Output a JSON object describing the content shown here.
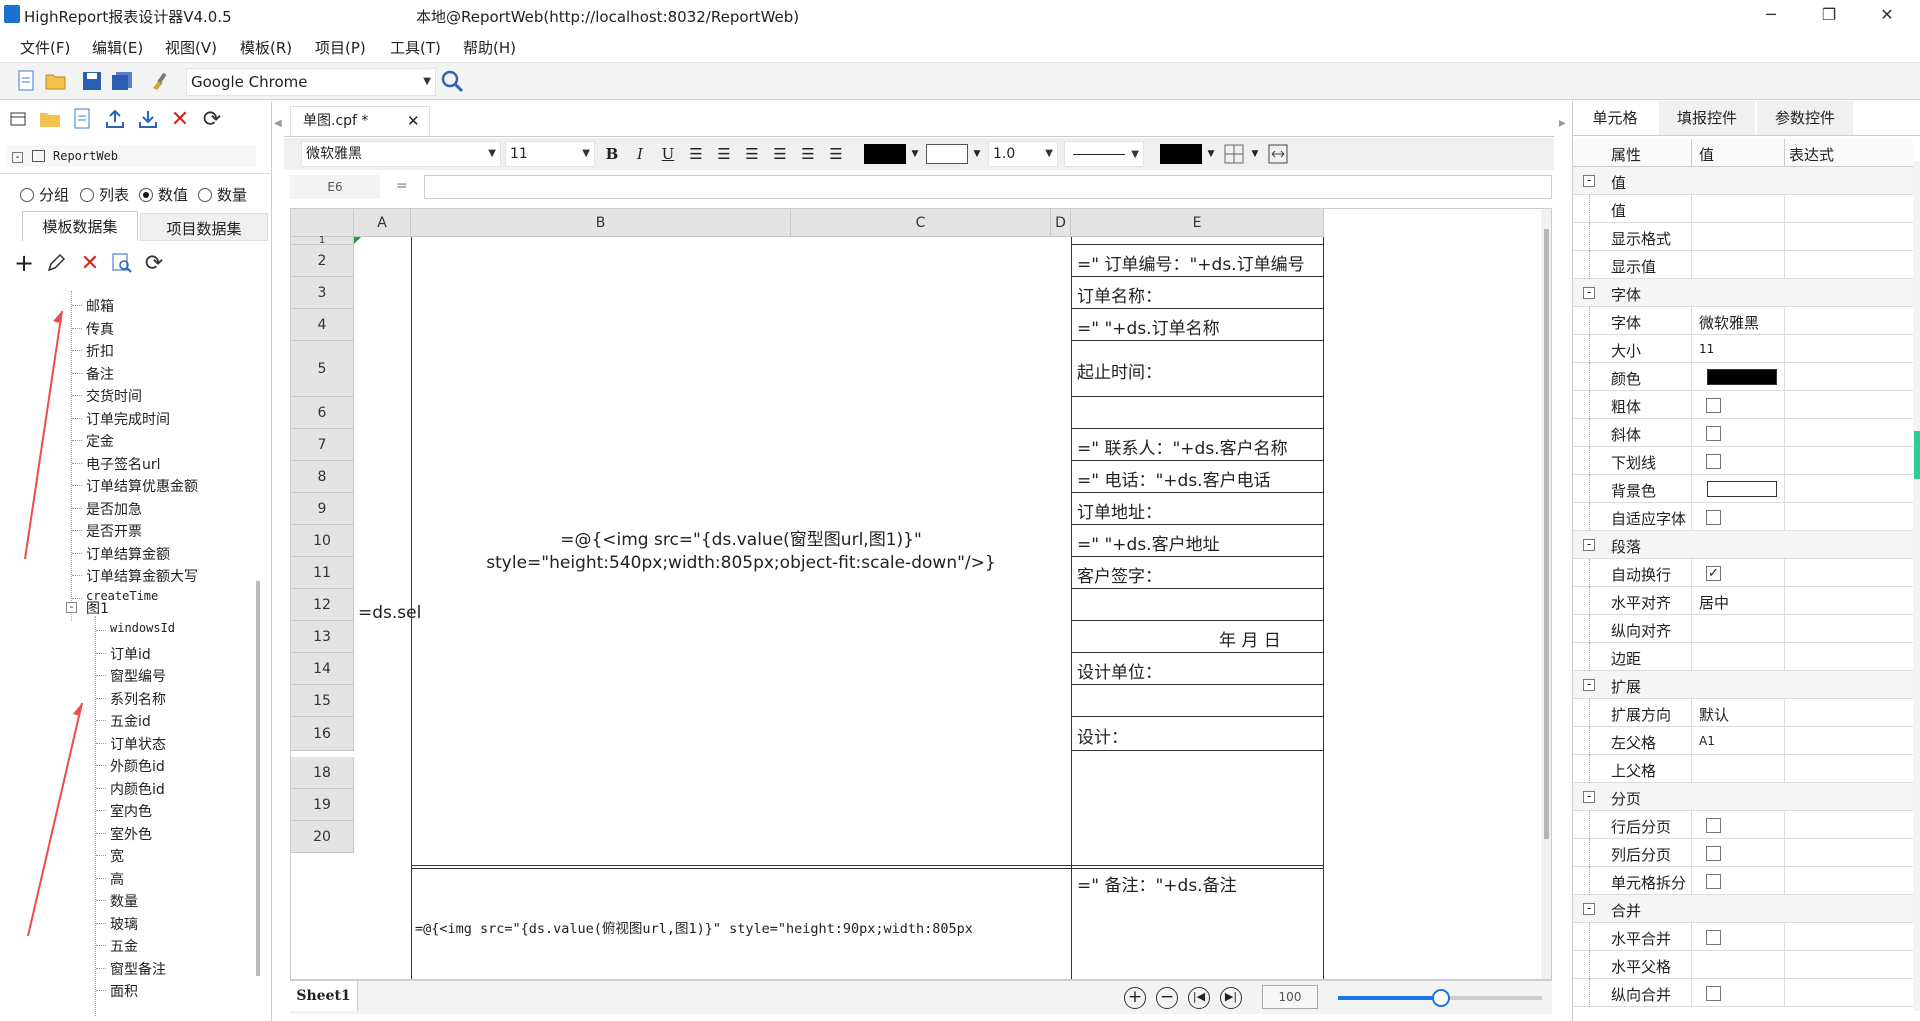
{
  "window": {
    "title": "HighReport报表设计器V4.0.5",
    "server": "本地@ReportWeb(http://localhost:8032/ReportWeb)"
  },
  "menu": [
    "文件(F)",
    "编辑(E)",
    "视图(V)",
    "模板(R)",
    "项目(P)",
    "工具(T)",
    "帮助(H)"
  ],
  "toolbar": {
    "browser": "Google Chrome"
  },
  "left": {
    "root": "ReportWeb",
    "radios": [
      {
        "label": "分组",
        "on": false
      },
      {
        "label": "列表",
        "on": false
      },
      {
        "label": "数值",
        "on": true
      },
      {
        "label": "数量",
        "on": false
      }
    ],
    "tabs": [
      "模板数据集",
      "项目数据集"
    ],
    "fields1": [
      "邮箱",
      "传真",
      "折扣",
      "备注",
      "交货时间",
      "订单完成时间",
      "定金",
      "电子签名url",
      "订单结算优惠金额",
      "是否加急",
      "是否开票",
      "订单结算金额",
      "订单结算金额大写",
      "createTime"
    ],
    "group": "图1",
    "fields2": [
      "windowsId",
      "订单id",
      "窗型编号",
      "系列名称",
      "五金id",
      "订单状态",
      "外颜色id",
      "内颜色id",
      "室内色",
      "室外色",
      "宽",
      "高",
      "数量",
      "玻璃",
      "五金",
      "窗型备注",
      "面积"
    ]
  },
  "doc": {
    "tab": "单图.cpf *",
    "font": "微软雅黑",
    "size": "11",
    "lineWidth": "1.0",
    "cellRef": "E6",
    "eq": "="
  },
  "sheet": {
    "cols": [
      "A",
      "B",
      "C",
      "D",
      "E"
    ],
    "rows": [
      "1",
      "2",
      "3",
      "4",
      "5",
      "6",
      "7",
      "8",
      "9",
      "10",
      "11",
      "12",
      "13",
      "14",
      "15",
      "16",
      "18",
      "19",
      "20"
    ],
    "cellA": "=ds.sel",
    "cellB1": "=@{<img src=\"{ds.value(窗型图url,图1)}\"",
    "cellB2": "style=\"height:540px;width:805px;object-fit:scale-down\"/>}",
    "cellB18": "=@{<img  src=\"{ds.value(俯视图url,图1)}\" style=\"height:90px;width:805px",
    "e": [
      "=\" 订单编号：\"+ds.订单编号",
      "订单名称：",
      "=\" \"+ds.订单名称",
      "起止时间：",
      "",
      "=\" 联系人：\"+ds.客户名称",
      "=\" 电话：\"+ds.客户电话",
      "订单地址：",
      "=\" \"+ds.客户地址",
      "客户签字：",
      "",
      "年     月     日",
      "设计单位：",
      "",
      "设计："
    ],
    "e18": "=\" 备注：\"+ds.备注",
    "sheetTab": "Sheet1",
    "zoom": "100"
  },
  "right": {
    "tabs": [
      "单元格",
      "填报控件",
      "参数控件"
    ],
    "headers": [
      "属性",
      "值",
      "表达式"
    ],
    "rows": [
      {
        "g": true,
        "label": "值"
      },
      {
        "label": "值",
        "val": ""
      },
      {
        "label": "显示格式",
        "val": ""
      },
      {
        "label": "显示值",
        "val": ""
      },
      {
        "g": true,
        "label": "字体"
      },
      {
        "label": "字体",
        "val": "微软雅黑"
      },
      {
        "label": "大小",
        "val": "11"
      },
      {
        "label": "颜色",
        "swatch": "#000000"
      },
      {
        "label": "粗体",
        "chk": false
      },
      {
        "label": "斜体",
        "chk": false
      },
      {
        "label": "下划线",
        "chk": false
      },
      {
        "label": "背景色",
        "swatch": "#ffffff"
      },
      {
        "label": "自适应字体",
        "chk": false
      },
      {
        "g": true,
        "label": "段落"
      },
      {
        "label": "自动换行",
        "chk": true
      },
      {
        "label": "水平对齐",
        "val": "居中"
      },
      {
        "label": "纵向对齐",
        "val": ""
      },
      {
        "label": "边距",
        "val": ""
      },
      {
        "g": true,
        "label": "扩展"
      },
      {
        "label": "扩展方向",
        "val": "默认"
      },
      {
        "label": "左父格",
        "val": "A1"
      },
      {
        "label": "上父格",
        "val": ""
      },
      {
        "g": true,
        "label": "分页"
      },
      {
        "label": "行后分页",
        "chk": false
      },
      {
        "label": "列后分页",
        "chk": false
      },
      {
        "label": "单元格拆分",
        "chk": false
      },
      {
        "g": true,
        "label": "合并"
      },
      {
        "label": "水平合并",
        "chk": false
      },
      {
        "label": "水平父格",
        "val": ""
      },
      {
        "label": "纵向合并",
        "chk": false
      }
    ]
  }
}
